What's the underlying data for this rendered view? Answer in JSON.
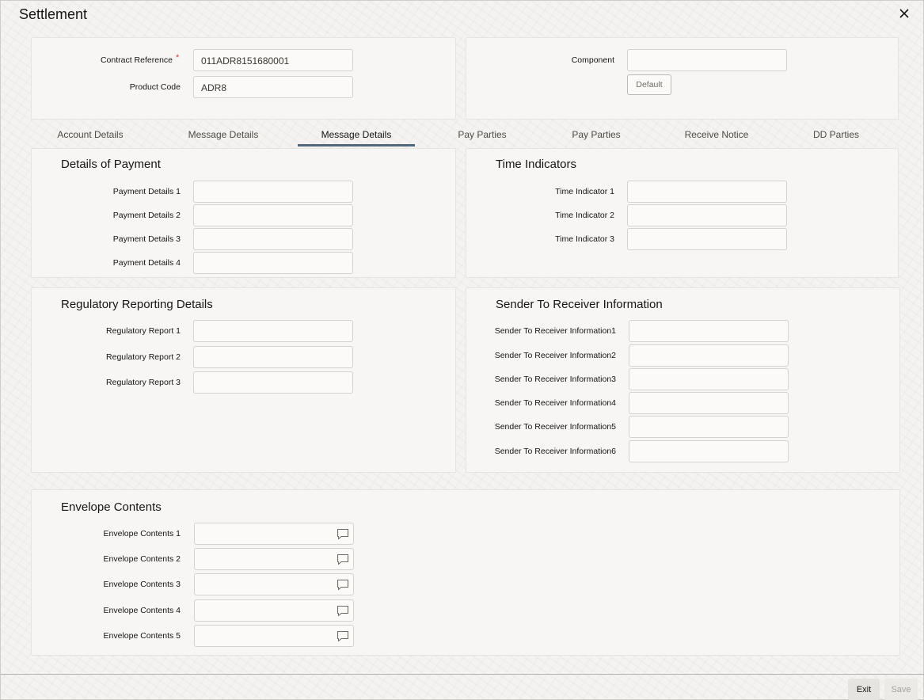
{
  "window": {
    "title": "Settlement"
  },
  "header_panel": {
    "contract_reference_label": "Contract Reference",
    "required_marker": "*",
    "contract_reference_value": "011ADR8151680001",
    "product_code_label": "Product Code",
    "product_code_value": "ADR8",
    "component_label": "Component",
    "component_value": "",
    "default_button": "Default"
  },
  "tabs": [
    {
      "label": "Account Details"
    },
    {
      "label": "Message Details"
    },
    {
      "label": "Message Details",
      "active": true
    },
    {
      "label": "Pay Parties"
    },
    {
      "label": "Pay Parties"
    },
    {
      "label": "Receive Notice"
    },
    {
      "label": "DD Parties"
    }
  ],
  "details_of_payment": {
    "title": "Details of Payment",
    "fields": [
      {
        "label": "Payment Details 1",
        "value": ""
      },
      {
        "label": "Payment Details 2",
        "value": ""
      },
      {
        "label": "Payment Details 3",
        "value": ""
      },
      {
        "label": "Payment Details 4",
        "value": ""
      }
    ]
  },
  "time_indicators": {
    "title": "Time Indicators",
    "fields": [
      {
        "label": "Time Indicator 1",
        "value": ""
      },
      {
        "label": "Time Indicator 2",
        "value": ""
      },
      {
        "label": "Time Indicator 3",
        "value": ""
      }
    ]
  },
  "regulatory_reporting": {
    "title": "Regulatory Reporting Details",
    "fields": [
      {
        "label": "Regulatory Report 1",
        "value": ""
      },
      {
        "label": "Regulatory Report 2",
        "value": ""
      },
      {
        "label": "Regulatory Report 3",
        "value": ""
      }
    ]
  },
  "sender_to_receiver": {
    "title": "Sender To Receiver Information",
    "fields": [
      {
        "label": "Sender To Receiver Information1",
        "value": ""
      },
      {
        "label": "Sender To Receiver Information2",
        "value": ""
      },
      {
        "label": "Sender To Receiver Information3",
        "value": ""
      },
      {
        "label": "Sender To Receiver Information4",
        "value": ""
      },
      {
        "label": "Sender To Receiver Information5",
        "value": ""
      },
      {
        "label": "Sender To Receiver Information6",
        "value": ""
      }
    ]
  },
  "envelope_contents": {
    "title": "Envelope Contents",
    "fields": [
      {
        "label": "Envelope Contents 1",
        "value": ""
      },
      {
        "label": "Envelope Contents 2",
        "value": ""
      },
      {
        "label": "Envelope Contents 3",
        "value": ""
      },
      {
        "label": "Envelope Contents 4",
        "value": ""
      },
      {
        "label": "Envelope Contents 5",
        "value": ""
      }
    ]
  },
  "footer": {
    "exit": "Exit",
    "save": "Save"
  },
  "icons": {
    "close": "close-icon",
    "comment": "comment-icon"
  },
  "colors": {
    "active_tab_underline": "#52677a",
    "required": "#c74634"
  }
}
